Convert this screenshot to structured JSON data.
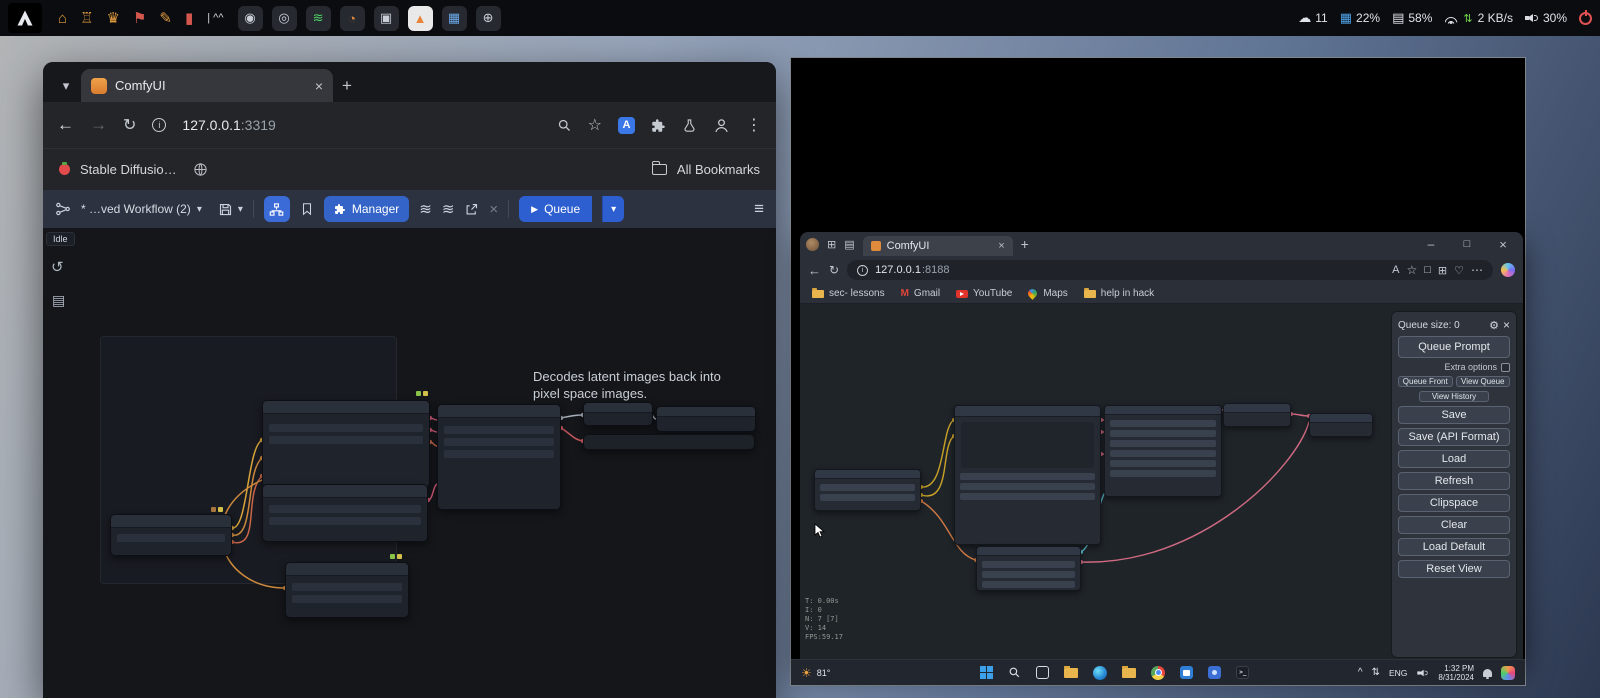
{
  "panel": {
    "separator_text": "| ^^",
    "tray": {
      "updates_count": "11",
      "cpu": "22%",
      "mem": "58%",
      "net": "2 KB/s",
      "volume": "30%"
    }
  },
  "left_window": {
    "tab": {
      "title": "ComfyUI"
    },
    "address": {
      "host": "127.0.0.1",
      "port": ":3319"
    },
    "bookmarks_bar": {
      "first_item": "Stable Diffusio…",
      "all_bookmarks": "All Bookmarks"
    },
    "comfy": {
      "workflow_label": "* …ved Workflow (2)",
      "manager_label": "Manager",
      "queue_label": "Queue",
      "status": "Idle",
      "tooltip": "Decodes latent images back into pixel space images."
    }
  },
  "right_window": {
    "tab": {
      "title": "ComfyUI"
    },
    "address": {
      "host": "127.0.0.1",
      "port": ":8188"
    },
    "bookmarks": [
      "sec- lessons",
      "Gmail",
      "YouTube",
      "Maps",
      "help in hack"
    ],
    "menu": {
      "queue_size": "Queue size: 0",
      "queue_prompt": "Queue Prompt",
      "extra_options": "Extra options",
      "queue_front": "Queue Front",
      "view_queue": "View Queue",
      "view_history": "View History",
      "buttons": [
        "Save",
        "Save (API Format)",
        "Load",
        "Refresh",
        "Clipspace",
        "Clear",
        "Load Default",
        "Reset View"
      ]
    },
    "stats": [
      "T: 0.00s",
      "I: 0",
      "N: 7 [7]",
      "V: 14",
      "FPS:59.17"
    ],
    "taskbar": {
      "temperature": "81°",
      "language": "ENG",
      "time": "1:32 PM",
      "date": "8/31/2024"
    }
  },
  "icons": {
    "chevron_down": "▾",
    "back": "←",
    "forward": "→",
    "reload": "↻",
    "info_letter": "i",
    "star": "☆",
    "translate_letter": "A",
    "kebab": "⋮",
    "plus": "+",
    "close": "×",
    "hamburger": "≡",
    "wave": "≋",
    "share_arrow": "↗",
    "play": "▶",
    "min": "–",
    "max": "□",
    "caret_up": "^",
    "gear": "⚙",
    "read_aloud": "A",
    "split": "□",
    "collections": "⊞",
    "essentials": "♡",
    "ellipsis": "⋯",
    "cloud": "☁",
    "cpu": "▦",
    "mem": "▤",
    "updown": "⇅",
    "workspaces": "⊞",
    "vtabs": "▤",
    "history": "↺",
    "list": "▤",
    "gmail": "M",
    "terminal": ">_",
    "launchers_left": [
      "⌂",
      "♖",
      "♛",
      "⚑",
      "✎",
      "▮"
    ],
    "launchers_right": [
      "◉",
      "◎",
      "≋",
      "◔",
      "▣",
      "▲",
      "▦",
      "⊕"
    ]
  },
  "colors": {
    "accent_blue": "#3a6bd8",
    "queue_button": "#2e5fd0",
    "wire_yellow": "#d9a53c",
    "wire_orange": "#cf8a3e",
    "wire_red": "#c9664a",
    "wire_pink": "#d05a78",
    "wire_teal": "#58b5c9"
  }
}
